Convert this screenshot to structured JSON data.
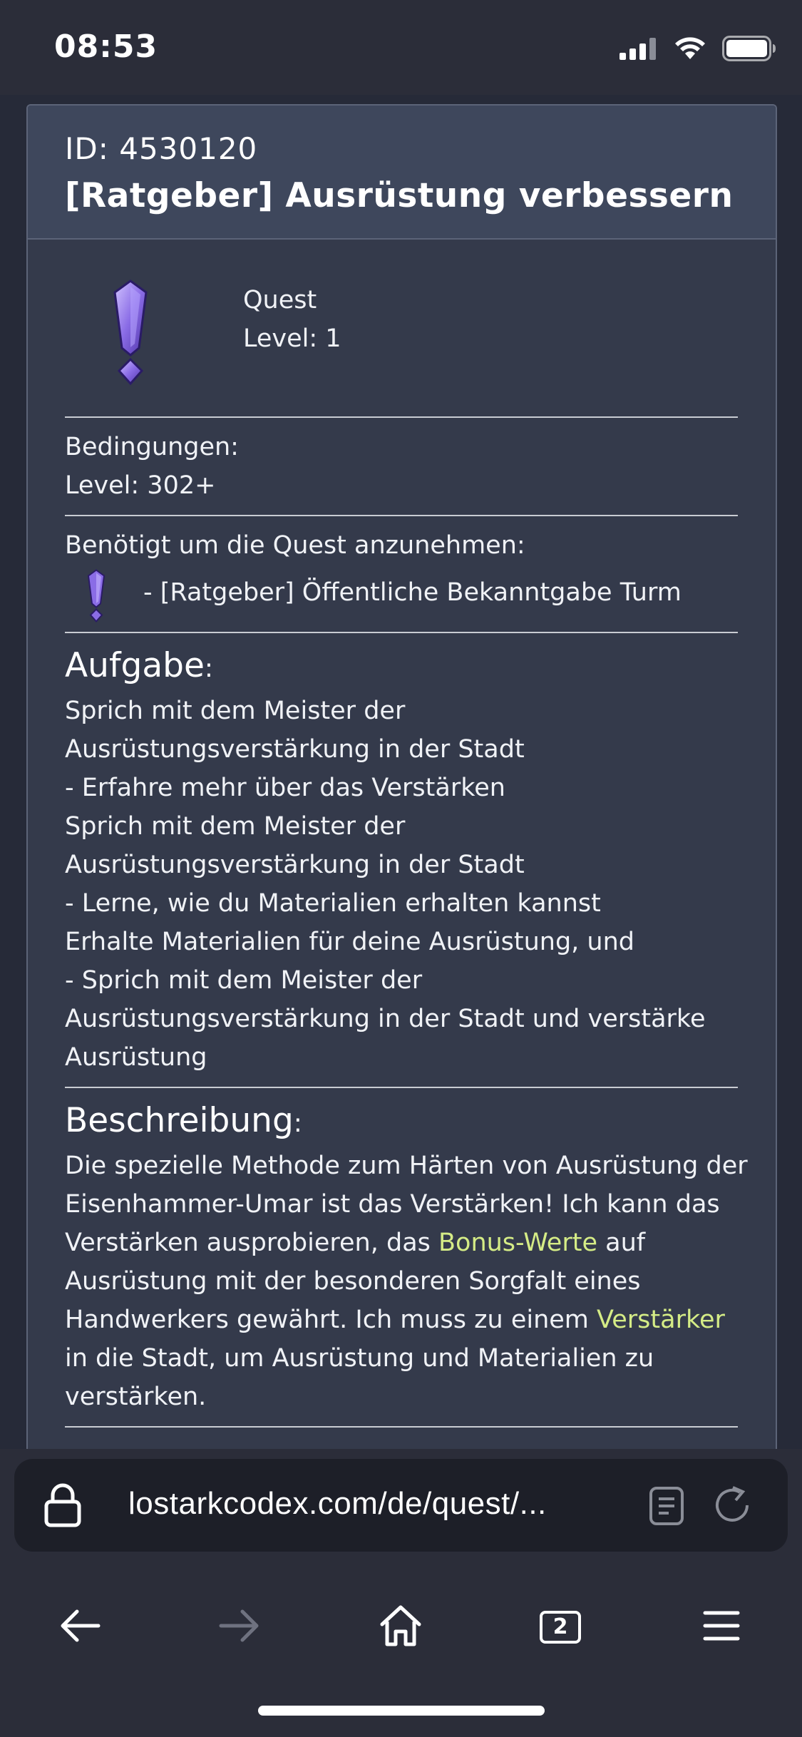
{
  "status_bar": {
    "time": "08:53",
    "icons": [
      "signal-icon",
      "wifi-icon",
      "battery-icon"
    ]
  },
  "quest": {
    "id_text": "ID: 4530120",
    "title": "[Ratgeber] Ausrüstung verbessern",
    "type": "Quest",
    "level": "Level: 1",
    "icon": "quest-exclamation-icon"
  },
  "conditions": {
    "label": "Bedingungen:",
    "level": "Level: 302+"
  },
  "requirement": {
    "label": "Benötigt um die Quest anzunehmen:",
    "item": "- [Ratgeber] Öffentliche Bekanntgabe Turm"
  },
  "task": {
    "heading": "Aufgabe",
    "colon": ":",
    "lines": [
      "Sprich mit dem Meister der",
      "Ausrüstungsverstärkung in der Stadt",
      "- Erfahre mehr über das Verstärken",
      "Sprich mit dem Meister der",
      "Ausrüstungsverstärkung in der Stadt",
      "- Lerne, wie du Materialien erhalten kannst",
      "Erhalte Materialien für deine Ausrüstung, und",
      "- Sprich mit dem Meister der",
      "Ausrüstungsverstärkung in der Stadt und verstärke",
      "Ausrüstung"
    ]
  },
  "description": {
    "heading": "Beschreibung",
    "colon": ":",
    "part1": "Die spezielle Methode zum Härten von Ausrüstung der Eisenhammer-Umar ist das Verstärken! Ich kann das Verstärken ausprobieren, das ",
    "highlight1": "Bonus-Werte",
    "part2": " auf Ausrüstung mit der besonderen Sorgfalt eines Handwerkers gewährt. Ich muss zu einem ",
    "highlight2": "Verstärker",
    "part3": " in die Stadt, um Ausrüstung und Materialien zu verstärken.",
    "highlight_color": "#d5ec86"
  },
  "browser": {
    "url": "lostarkcodex.com/de/quest/...",
    "tab_count": "2",
    "icons": [
      "lock-icon",
      "reader-icon",
      "reload-icon",
      "back-arrow-icon",
      "forward-arrow-icon",
      "home-icon",
      "tabs-icon",
      "menu-icon"
    ]
  }
}
